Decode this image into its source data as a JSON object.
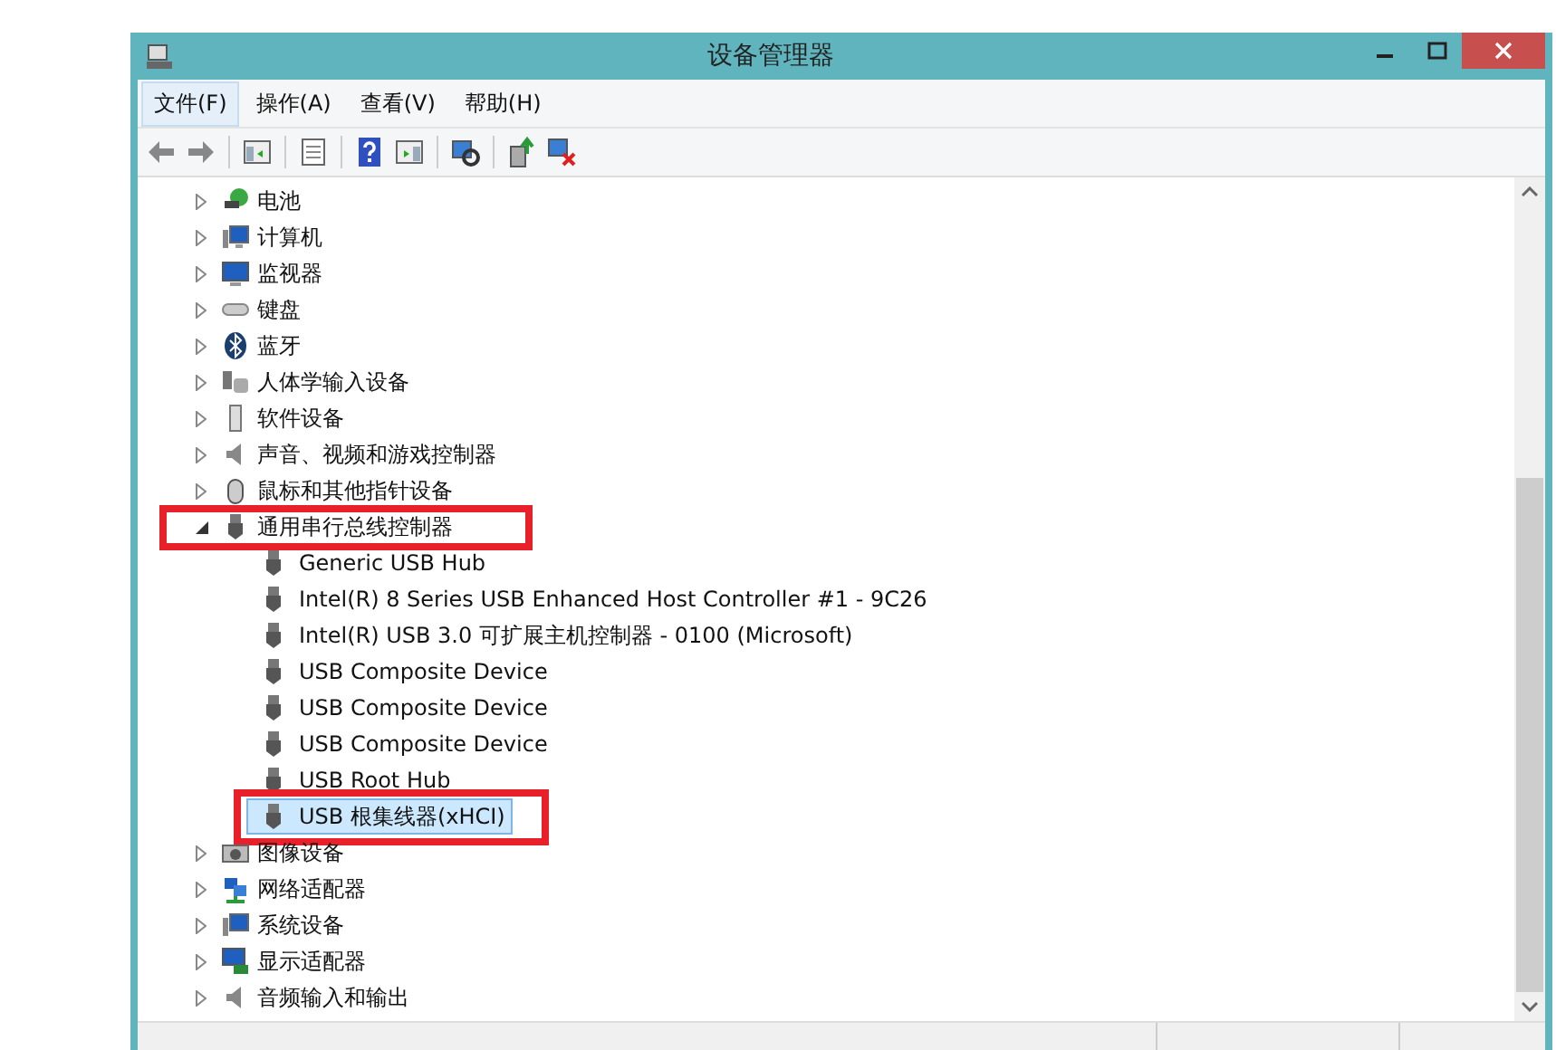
{
  "window": {
    "title": "设备管理器"
  },
  "menu": [
    {
      "label": "文件(F)",
      "selected": true
    },
    {
      "label": "操作(A)",
      "selected": false
    },
    {
      "label": "查看(V)",
      "selected": false
    },
    {
      "label": "帮助(H)",
      "selected": false
    }
  ],
  "tree": [
    {
      "label": "电池",
      "expanded": false,
      "marked": false
    },
    {
      "label": "计算机",
      "expanded": false,
      "marked": false
    },
    {
      "label": "监视器",
      "expanded": false,
      "marked": false
    },
    {
      "label": "键盘",
      "expanded": false,
      "marked": false
    },
    {
      "label": "蓝牙",
      "expanded": false,
      "marked": false
    },
    {
      "label": "人体学输入设备",
      "expanded": false,
      "marked": false
    },
    {
      "label": "软件设备",
      "expanded": false,
      "marked": false
    },
    {
      "label": "声音、视频和游戏控制器",
      "expanded": false,
      "marked": false
    },
    {
      "label": "鼠标和其他指针设备",
      "expanded": false,
      "marked": false
    },
    {
      "label": "通用串行总线控制器",
      "expanded": true,
      "marked": true,
      "children": [
        {
          "label": "Generic USB Hub",
          "selected": false,
          "marked": false
        },
        {
          "label": "Intel(R) 8 Series USB Enhanced Host Controller #1 - 9C26",
          "selected": false,
          "marked": false
        },
        {
          "label": "Intel(R) USB 3.0 可扩展主机控制器 - 0100 (Microsoft)",
          "selected": false,
          "marked": false
        },
        {
          "label": "USB Composite Device",
          "selected": false,
          "marked": false
        },
        {
          "label": "USB Composite Device",
          "selected": false,
          "marked": false
        },
        {
          "label": "USB Composite Device",
          "selected": false,
          "marked": false
        },
        {
          "label": "USB Root Hub",
          "selected": false,
          "marked": false
        },
        {
          "label": "USB 根集线器(xHCI)",
          "selected": true,
          "marked": true
        }
      ]
    },
    {
      "label": "图像设备",
      "expanded": false,
      "marked": false
    },
    {
      "label": "网络适配器",
      "expanded": false,
      "marked": false
    },
    {
      "label": "系统设备",
      "expanded": false,
      "marked": false
    },
    {
      "label": "显示适配器",
      "expanded": false,
      "marked": false
    },
    {
      "label": "音频输入和输出",
      "expanded": false,
      "marked": false
    }
  ]
}
